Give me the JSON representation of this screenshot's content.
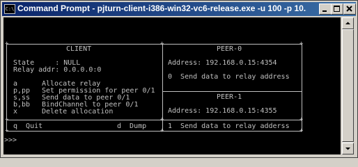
{
  "window": {
    "title": "Command Prompt - pjturn-client-i386-win32-vc6-release.exe -u 100 -p 10...",
    "app_icon": "C:\\",
    "buttons": {
      "minimize": "minimize-icon",
      "maximize": "maximize-icon",
      "close": "close-icon"
    }
  },
  "client": {
    "header": "CLIENT",
    "state_line": "State     : NULL",
    "relay_line": "Relay addr: 0.0.0.0:0",
    "menu": [
      {
        "key": "a",
        "label": "Allocate relay"
      },
      {
        "key": "p,pp",
        "label": "Set permission for peer 0/1"
      },
      {
        "key": "s,ss",
        "label": "Send data to peer 0/1"
      },
      {
        "key": "b,bb",
        "label": "BindChannel to peer 0/1"
      },
      {
        "key": "x",
        "label": "Delete allocation"
      }
    ],
    "quit": "q  Quit",
    "dump": "d  Dump"
  },
  "peer0": {
    "header": "PEER-0",
    "address": "Address: 192.168.0.15:4354",
    "action": "0  Send data to relay address"
  },
  "peer1": {
    "header": "PEER-1",
    "address": "Address: 192.168.0.15:4355",
    "action": "1  Send data to relay adderss"
  },
  "prompt": ">>>"
}
